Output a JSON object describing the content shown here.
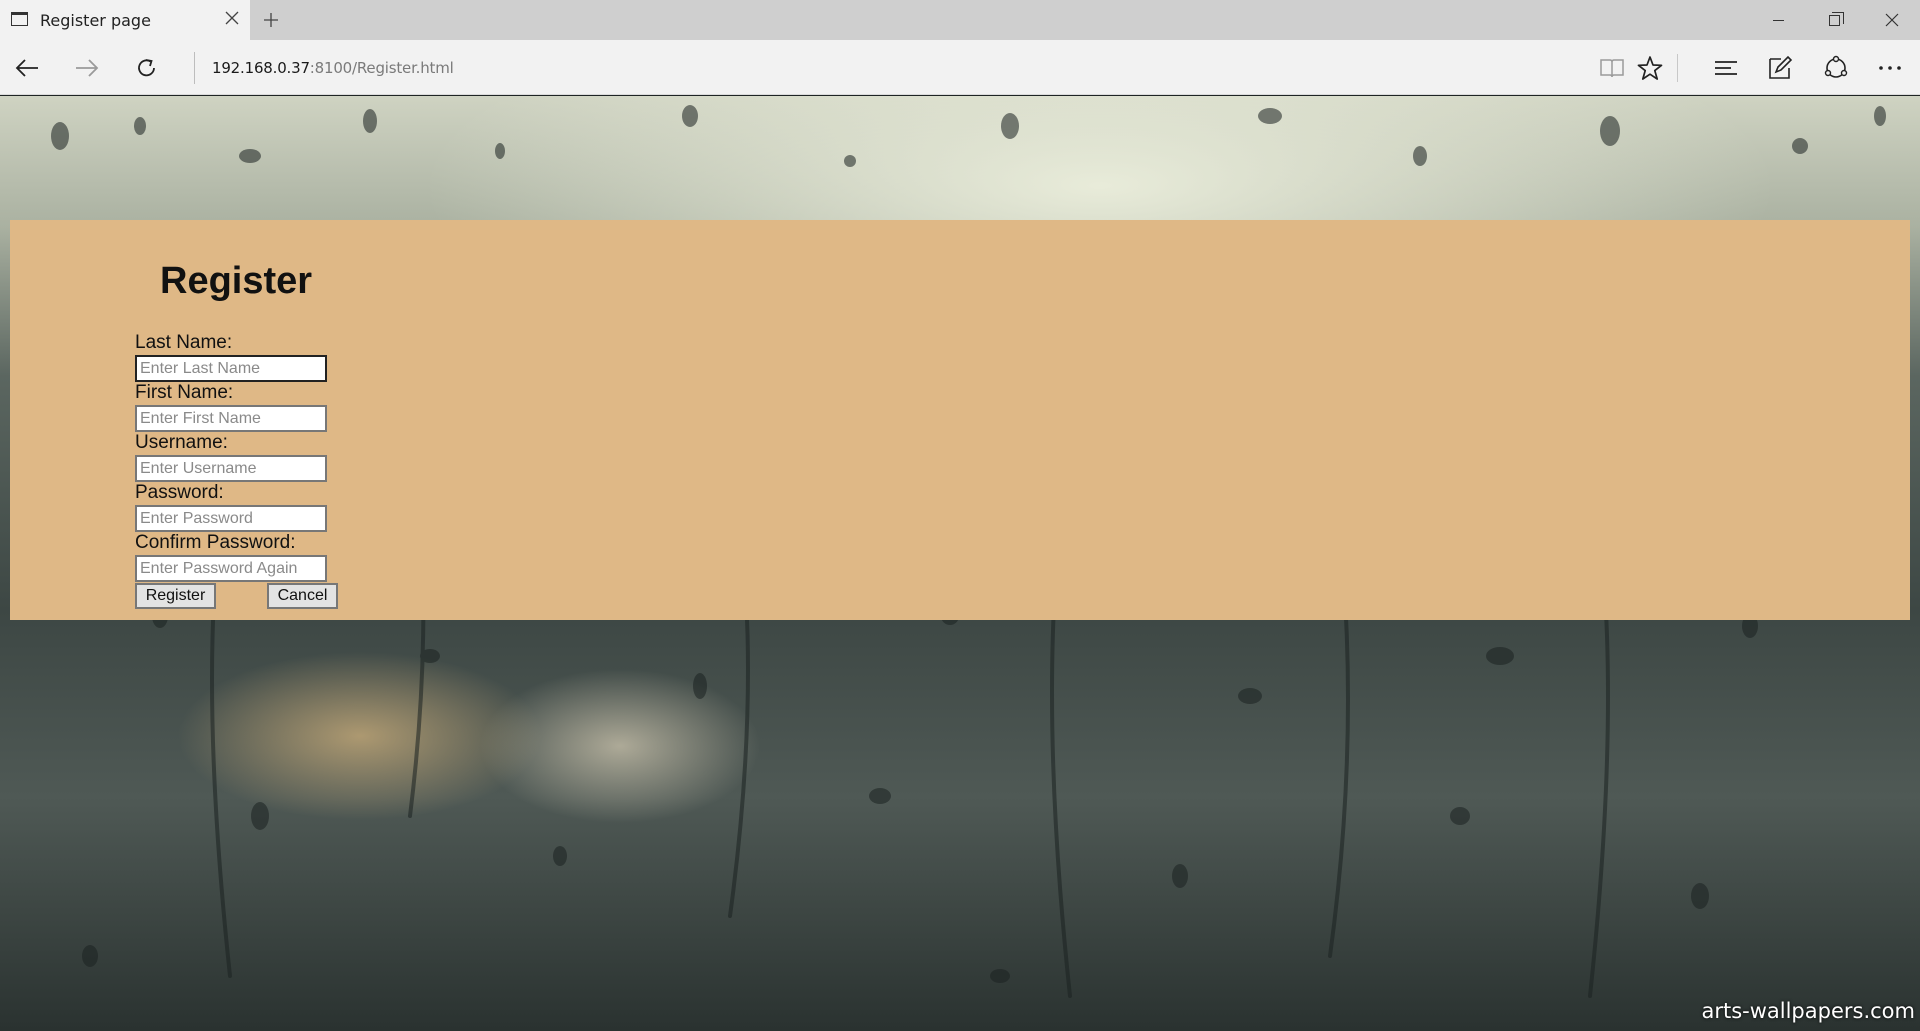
{
  "browser": {
    "tab_title": "Register page",
    "address_host": "192.168.0.37",
    "address_rest": ":8100/Register.html"
  },
  "page": {
    "heading": "Register",
    "watermark": "arts-wallpapers.com",
    "panel_color": "#dfb886"
  },
  "form": {
    "last_name": {
      "label": "Last Name:",
      "placeholder": "Enter Last Name",
      "value": ""
    },
    "first_name": {
      "label": "First Name:",
      "placeholder": "Enter First Name",
      "value": ""
    },
    "username": {
      "label": "Username:",
      "placeholder": "Enter Username",
      "value": ""
    },
    "password": {
      "label": "Password:",
      "placeholder": "Enter Password",
      "value": ""
    },
    "confirm_password": {
      "label": "Confirm Password:",
      "placeholder": "Enter Password Again",
      "value": ""
    },
    "register_label": "Register",
    "cancel_label": "Cancel"
  },
  "icons": {
    "tab": "tab-page-icon",
    "close_tab": "close-icon",
    "new_tab": "plus-icon",
    "back": "arrow-left-icon",
    "forward": "arrow-right-icon",
    "refresh": "refresh-icon",
    "reading_view": "book-icon",
    "favorite": "star-icon",
    "hub": "hub-icon",
    "web_note": "pen-icon",
    "share": "share-icon",
    "more": "more-icon"
  }
}
